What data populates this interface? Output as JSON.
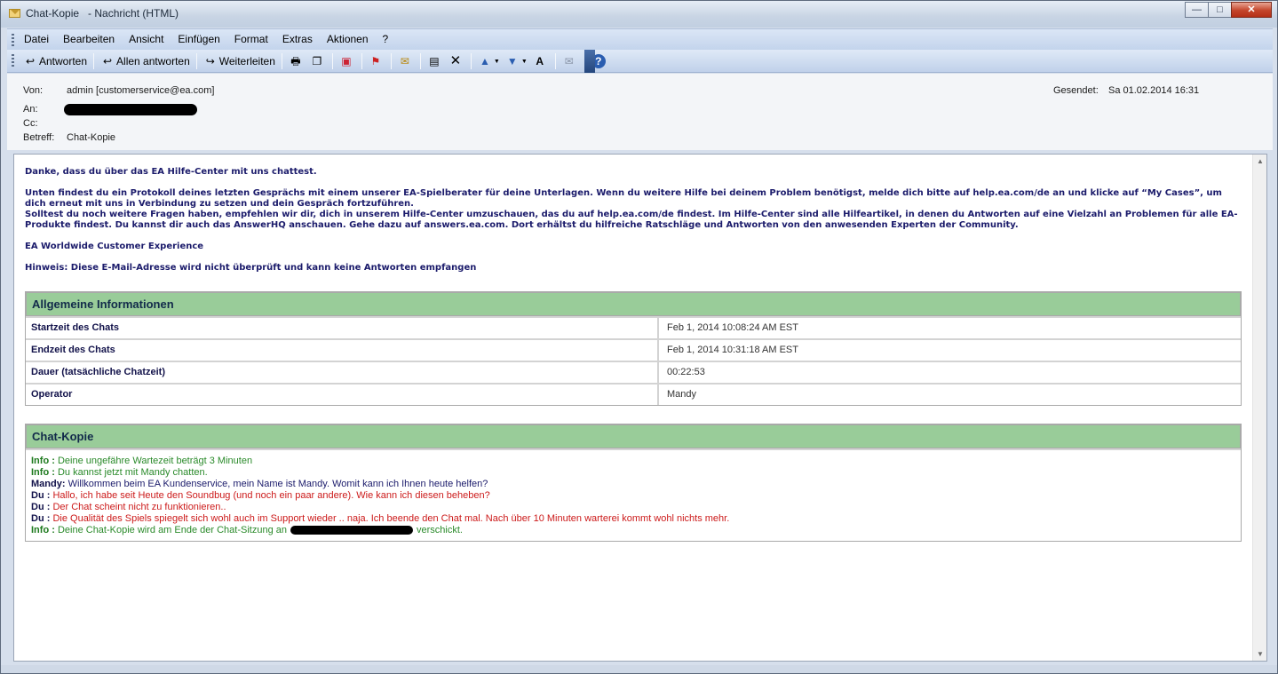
{
  "window": {
    "title": "Chat-Kopie   - Nachricht (HTML)",
    "minimize": "—",
    "maximize": "□",
    "close": "✕"
  },
  "menubar": {
    "items": [
      "Datei",
      "Bearbeiten",
      "Ansicht",
      "Einfügen",
      "Format",
      "Extras",
      "Aktionen",
      "?"
    ]
  },
  "toolbar": {
    "reply": "Antworten",
    "reply_all": "Allen antworten",
    "forward": "Weiterleiten"
  },
  "header": {
    "from_label": "Von:",
    "from_value": "admin [customerservice@ea.com]",
    "to_label": "An:",
    "cc_label": "Cc:",
    "subject_label": "Betreff:",
    "subject_value": "Chat-Kopie",
    "sent_label": "Gesendet:",
    "sent_value": "Sa 01.02.2014 16:31"
  },
  "message": {
    "p1": "Danke, dass du über das EA Hilfe-Center mit uns chattest.",
    "p2a": "Unten findest du ein Protokoll deines letzten Gesprächs mit einem unserer EA-Spielberater für deine Unterlagen. Wenn du weitere Hilfe bei deinem Problem benötigst, melde dich bitte auf help.ea.com/de an und klicke auf “My Cases”, um dich erneut mit uns in Verbindung zu setzen und dein Gespräch fortzuführen.",
    "p2b": "Solltest du noch weitere Fragen haben, empfehlen wir dir, dich in unserem Hilfe-Center umzuschauen, das du auf help.ea.com/de findest. Im Hilfe-Center sind alle Hilfeartikel, in denen du Antworten auf eine Vielzahl an Problemen für alle EA-Produkte findest. Du kannst dir auch das AnswerHQ anschauen. Gehe dazu auf answers.ea.com. Dort erhältst du hilfreiche Ratschläge und Antworten von den anwesenden Experten der Community.",
    "p3": "EA Worldwide Customer Experience",
    "p4": "Hinweis: Diese E-Mail-Adresse wird nicht überprüft und kann keine Antworten empfangen"
  },
  "info_table": {
    "heading": "Allgemeine Informationen",
    "rows": [
      {
        "label": "Startzeit des Chats",
        "value": "Feb 1, 2014 10:08:24 AM EST"
      },
      {
        "label": "Endzeit des Chats",
        "value": "Feb 1, 2014 10:31:18 AM EST"
      },
      {
        "label": "Dauer (tatsächliche Chatzeit)",
        "value": "00:22:53"
      },
      {
        "label": "Operator",
        "value": "Mandy"
      }
    ]
  },
  "chat": {
    "heading": "Chat-Kopie",
    "lines": [
      {
        "who": "Info :",
        "text": "Deine ungefähre Wartezeit beträgt 3 Minuten"
      },
      {
        "who": "Info :",
        "text": "Du kannst jetzt mit Mandy chatten."
      },
      {
        "who": "Mandy:",
        "text": "Willkommen beim EA Kundenservice, mein Name ist Mandy. Womit kann ich Ihnen heute helfen?"
      },
      {
        "who": "Du :",
        "text": "Hallo, ich habe seit Heute den Soundbug (und noch ein paar andere). Wie kann ich diesen beheben?"
      },
      {
        "who": "Du :",
        "text": "Der Chat scheint nicht zu funktionieren.."
      },
      {
        "who": "Du :",
        "text": "Die Qualität des Spiels spiegelt sich wohl auch im Support wieder .. naja. Ich beende den Chat mal. Nach über 10 Minuten warterei kommt wohl nichts mehr."
      },
      {
        "who": "Info :",
        "text_before": "Deine Chat-Kopie wird am Ende der Chat-Sitzung an",
        "text_after": "verschickt."
      }
    ]
  },
  "colors": {
    "section_header": "#99cc99",
    "info_text": "#2a8a2a",
    "du_text": "#cc1a1a",
    "mandy_text": "#1b1b6b"
  }
}
